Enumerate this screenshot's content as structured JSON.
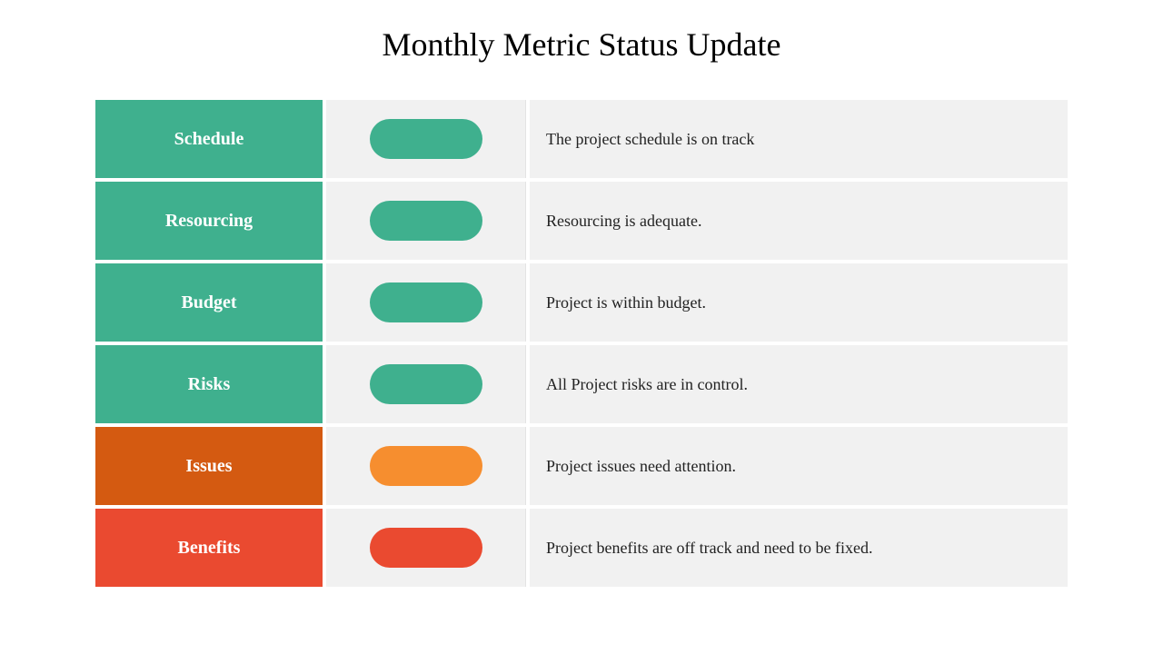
{
  "title": "Monthly Metric Status Update",
  "colors": {
    "green": "#3fb08e",
    "orange_bg": "#d45a11",
    "orange_pill": "#f68e2f",
    "red": "#ea4a30"
  },
  "rows": [
    {
      "label": "Schedule",
      "labelColor": "#3fb08e",
      "pillColor": "#3fb08e",
      "desc": "The project schedule is on track"
    },
    {
      "label": "Resourcing",
      "labelColor": "#3fb08e",
      "pillColor": "#3fb08e",
      "desc": "Resourcing is adequate."
    },
    {
      "label": "Budget",
      "labelColor": "#3fb08e",
      "pillColor": "#3fb08e",
      "desc": "Project is within budget."
    },
    {
      "label": "Risks",
      "labelColor": "#3fb08e",
      "pillColor": "#3fb08e",
      "desc": "All Project risks are in control."
    },
    {
      "label": "Issues",
      "labelColor": "#d45a11",
      "pillColor": "#f68e2f",
      "desc": "Project issues need attention."
    },
    {
      "label": "Benefits",
      "labelColor": "#ea4a30",
      "pillColor": "#ea4a30",
      "desc": "Project benefits are off track and need to be fixed."
    }
  ]
}
